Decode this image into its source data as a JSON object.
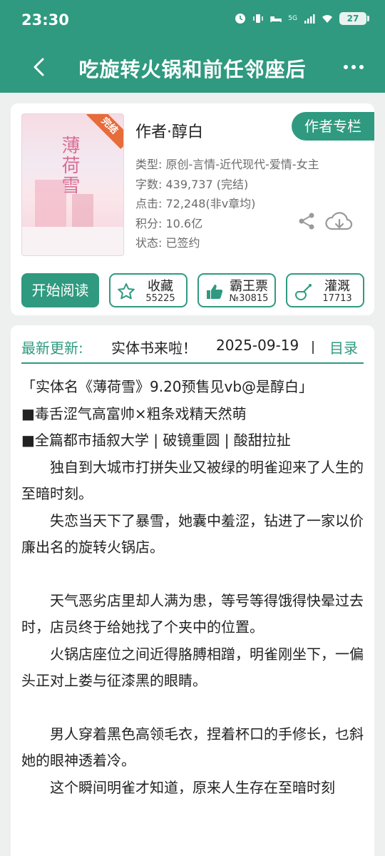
{
  "status": {
    "time": "23:30",
    "battery": "27",
    "net": "5G"
  },
  "header": {
    "title": "吃旋转火锅和前任邻座后"
  },
  "book": {
    "author_line": "作者·醇白",
    "author_column": "作者专栏",
    "complete_tag": "完结",
    "cover_title": "薄荷雪",
    "meta": {
      "type": "类型: 原创-言情-近代现代-爱情-女主",
      "words": "字数: 439,737 (完结)",
      "clicks": "点击: 72,248(非v章均)",
      "points": "积分: 10.6亿",
      "state": "状态: 已签约"
    }
  },
  "actions": {
    "read": "开始阅读",
    "collect": {
      "label": "收藏",
      "count": "55225"
    },
    "ticket": {
      "label": "霸王票",
      "count": "№30815"
    },
    "irrigate": {
      "label": "灌溉",
      "count": "17713"
    }
  },
  "latest": {
    "label": "最新更新:",
    "chapter": "实体书来啦！",
    "date": "2025-09-19",
    "toc": "目录"
  },
  "description": [
    "「实体名《薄荷雪》9.20预售见vb@是醇白」",
    "■毒舌涩气高富帅×粗条戏精天然萌",
    "■全篇都市插叙大学 | 破镜重圆 | 酸甜拉扯",
    "独自到大城市打拼失业又被绿的明雀迎来了人生的至暗时刻。",
    "失恋当天下了暴雪，她囊中羞涩，钻进了一家以价廉出名的旋转火锅店。",
    "天气恶劣店里却人满为患，等号等得饿得快晕过去时，店员终于给她找了个夹中的位置。",
    "火锅店座位之间近得胳膊相蹭，明雀刚坐下，一偏头正对上娄与征漆黑的眼睛。",
    "男人穿着黑色高领毛衣，捏着杯口的手修长，乜斜她的眼神透着冷。",
    "这个瞬间明雀才知道，原来人生存在至暗时刻"
  ],
  "colors": {
    "accent": "#2f9a80",
    "background": "#eef0ef"
  }
}
